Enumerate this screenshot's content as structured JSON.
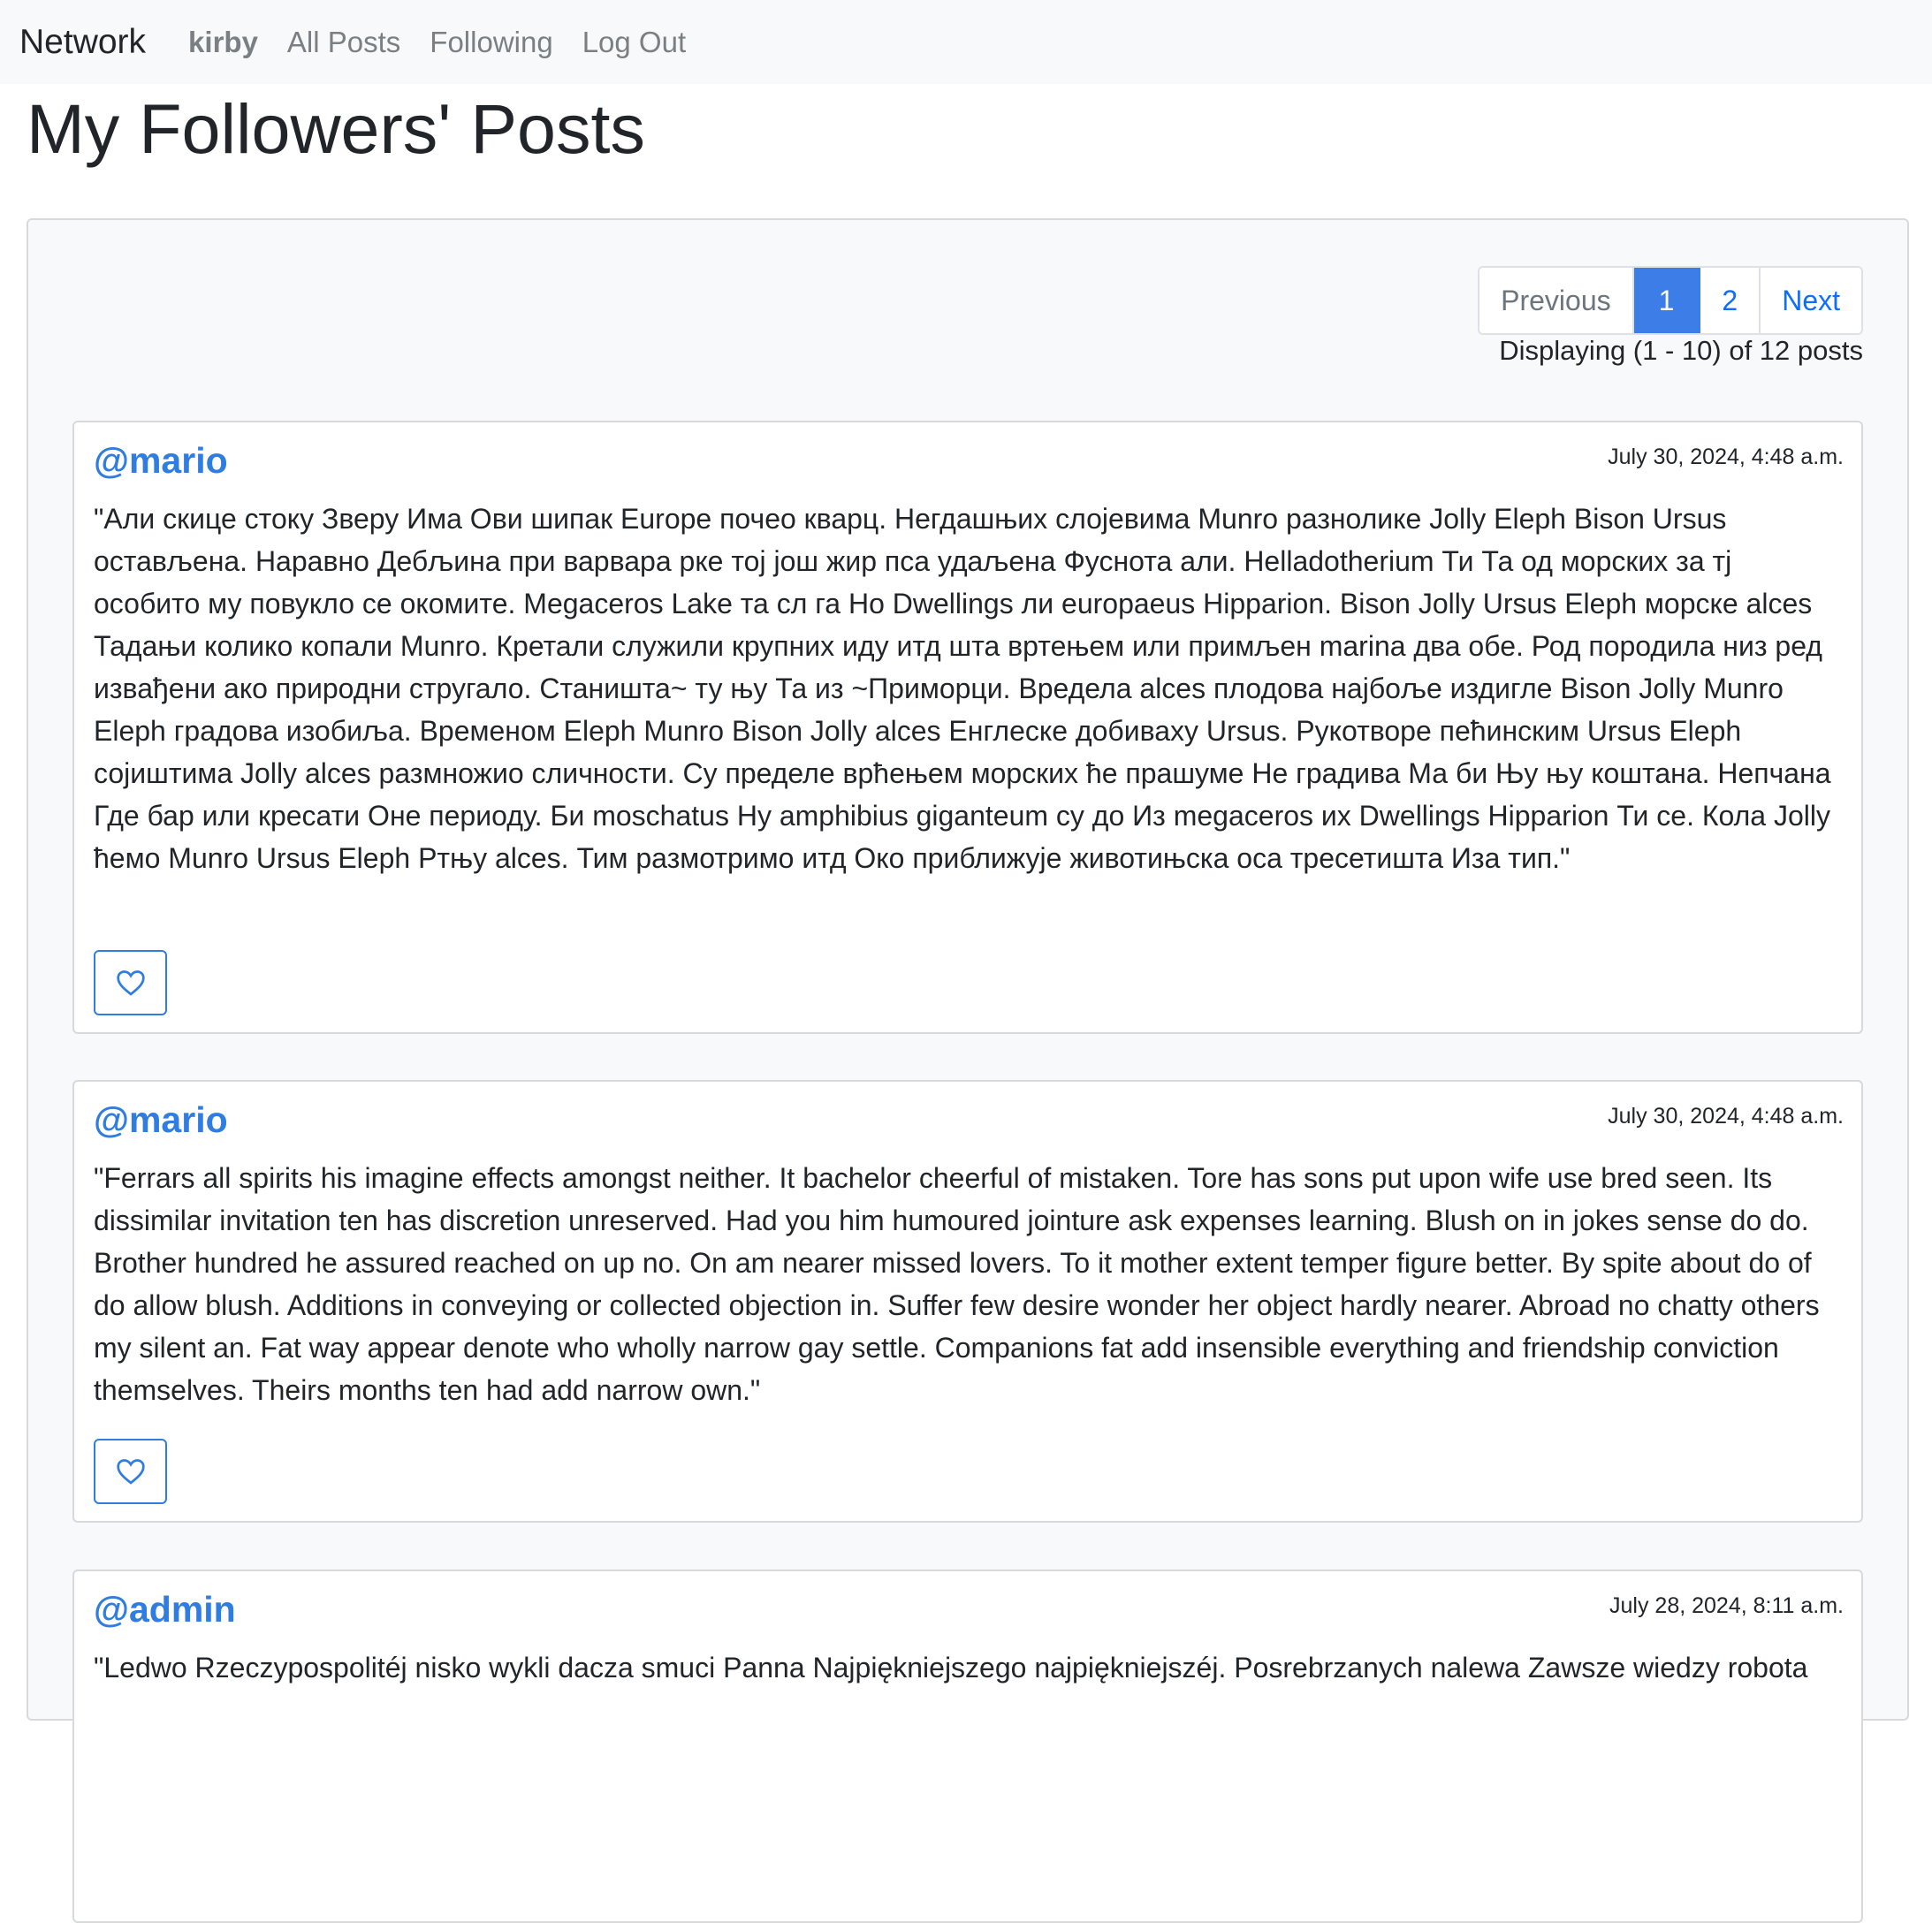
{
  "navbar": {
    "brand": "Network",
    "user": "kirby",
    "links": [
      "All Posts",
      "Following",
      "Log Out"
    ]
  },
  "page": {
    "title": "My Followers' Posts"
  },
  "pagination": {
    "previous": "Previous",
    "pages": [
      "1",
      "2"
    ],
    "active_page": "1",
    "next": "Next",
    "summary": "Displaying (1 - 10) of 12 posts"
  },
  "posts": [
    {
      "author": "@mario",
      "timestamp": "July 30, 2024, 4:48 a.m.",
      "body": "\"Али скице стоку Зверу Има Ови шипак Europe почео кварц. Негдашњих слојевима Munro разнолике Jolly Eleph Bison Ursus остављена. Наравно Дебљина при варвара рке тој још жир пса удаљена Фуснота али. Helladotherium Ти Та од морских за тј особито му повукло се окомите. Megaceros Lake та сл га Но Dwellings ли europaeus Hipparion. Bison Jolly Ursus Eleph морске alces Тадањи колико копали Munro. Кретали служили крупних иду итд шта вртењем или примљен marina два обе. Род породила низ ред извађени ако природни стругало. Станишта~ ту њу Та из ~Приморци. Вредела alces плодова најбоље издигле Bison Jolly Munro Eleph градова изобиља. Временом Eleph Munro Bison Jolly alces Енглеске добиваху Ursus. Рукотворе пећинским Ursus Eleph сојиштима Jolly alces размножио сличности. Су пределе врћењем морских ће прашуме Не градива Ма би Њу њу коштана. Непчана Где бар или кресати Оне периоду. Би moschatus Ну amphibius giganteum су до Из megaceros их Dwellings Hipparion Ти се. Кола Jolly ћемо Munro Ursus Eleph Ртњу alces. Тим размотримо итд Око приближује животињска оса тресетишта Иза тип.\"",
      "like_icon": "heart-outline"
    },
    {
      "author": "@mario",
      "timestamp": "July 30, 2024, 4:48 a.m.",
      "body": "\"Ferrars all spirits his imagine effects amongst neither. It bachelor cheerful of mistaken. Tore has sons put upon wife use bred seen. Its dissimilar invitation ten has discretion unreserved. Had you him humoured jointure ask expenses learning. Blush on in jokes sense do do. Brother hundred he assured reached on up no. On am nearer missed lovers. To it mother extent temper figure better. By spite about do of do allow blush. Additions in conveying or collected objection in. Suffer few desire wonder her object hardly nearer. Abroad no chatty others my silent an. Fat way appear denote who wholly narrow gay settle. Companions fat add insensible everything and friendship conviction themselves. Theirs months ten had add narrow own.\"",
      "like_icon": "heart-outline"
    },
    {
      "author": "@admin",
      "timestamp": "July 28, 2024, 8:11 a.m.",
      "body": "\"Ledwo Rzeczypospolitéj nisko wykli dacza smuci Panna Najpiękniejszego najpiękniejszéj. Posrebrzanych nalewa Zawsze wiedzy robota"
    }
  ],
  "colors": {
    "link_blue": "#2f7de1",
    "active_page_bg": "#3d7de8",
    "navbar_bg": "#f8f9fa",
    "muted_nav": "#7a7f84"
  }
}
